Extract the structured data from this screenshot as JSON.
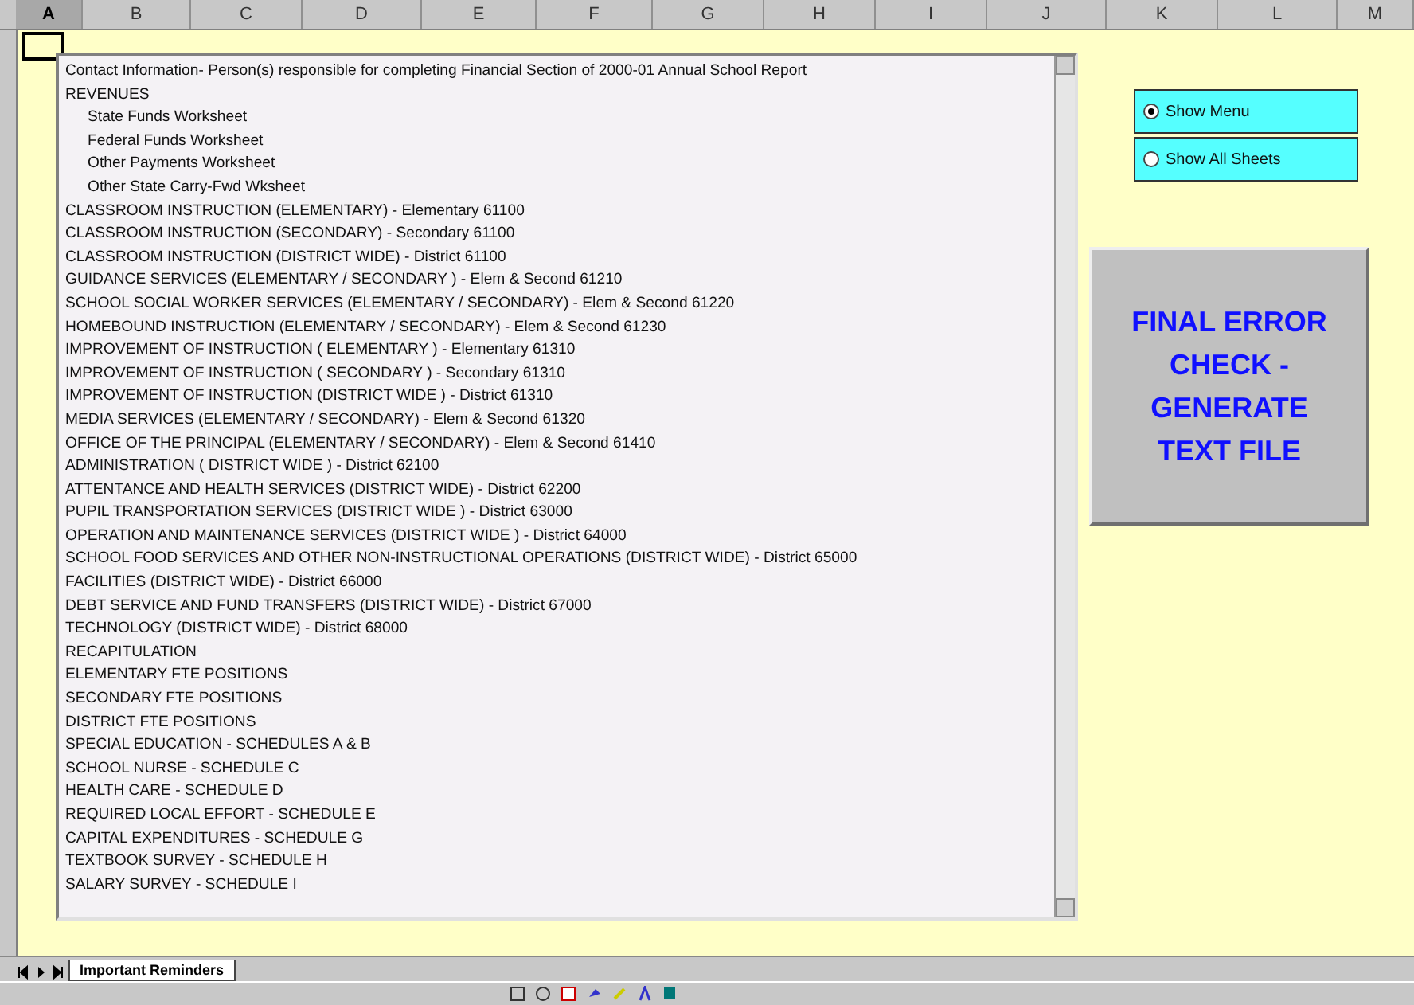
{
  "columns": [
    {
      "label": "A",
      "selected": true
    },
    {
      "label": "B",
      "selected": false
    },
    {
      "label": "C",
      "selected": false
    },
    {
      "label": "D",
      "selected": false
    },
    {
      "label": "E",
      "selected": false
    },
    {
      "label": "F",
      "selected": false
    },
    {
      "label": "G",
      "selected": false
    },
    {
      "label": "H",
      "selected": false
    },
    {
      "label": "I",
      "selected": false
    },
    {
      "label": "J",
      "selected": false
    },
    {
      "label": "K",
      "selected": false
    },
    {
      "label": "L",
      "selected": false
    },
    {
      "label": "M",
      "selected": false
    }
  ],
  "list_items": [
    {
      "text": "Contact Information- Person(s) responsible for completing Financial Section of 2000-01 Annual School Report",
      "indented": false
    },
    {
      "text": "REVENUES",
      "indented": false
    },
    {
      "text": "State Funds Worksheet",
      "indented": true
    },
    {
      "text": "Federal Funds Worksheet",
      "indented": true
    },
    {
      "text": "Other Payments Worksheet",
      "indented": true
    },
    {
      "text": "Other State Carry-Fwd Wksheet",
      "indented": true
    },
    {
      "text": "CLASSROOM INSTRUCTION (ELEMENTARY) - Elementary 61100",
      "indented": false
    },
    {
      "text": "CLASSROOM INSTRUCTION (SECONDARY) - Secondary 61100",
      "indented": false
    },
    {
      "text": "CLASSROOM INSTRUCTION (DISTRICT WIDE) - District 61100",
      "indented": false
    },
    {
      "text": "GUIDANCE SERVICES (ELEMENTARY / SECONDARY ) - Elem & Second 61210",
      "indented": false
    },
    {
      "text": "SCHOOL SOCIAL WORKER SERVICES (ELEMENTARY / SECONDARY) - Elem & Second 61220",
      "indented": false
    },
    {
      "text": "HOMEBOUND INSTRUCTION (ELEMENTARY / SECONDARY) - Elem & Second 61230",
      "indented": false
    },
    {
      "text": "IMPROVEMENT OF INSTRUCTION ( ELEMENTARY ) - Elementary 61310",
      "indented": false
    },
    {
      "text": "IMPROVEMENT OF INSTRUCTION ( SECONDARY ) - Secondary 61310",
      "indented": false
    },
    {
      "text": "IMPROVEMENT OF INSTRUCTION (DISTRICT WIDE ) - District 61310",
      "indented": false
    },
    {
      "text": "MEDIA SERVICES (ELEMENTARY / SECONDARY) - Elem & Second 61320",
      "indented": false
    },
    {
      "text": "OFFICE OF THE PRINCIPAL (ELEMENTARY / SECONDARY) - Elem & Second 61410",
      "indented": false
    },
    {
      "text": "ADMINISTRATION ( DISTRICT WIDE ) - District 62100",
      "indented": false
    },
    {
      "text": "ATTENTANCE AND HEALTH SERVICES (DISTRICT WIDE) - District 62200",
      "indented": false
    },
    {
      "text": "PUPIL TRANSPORTATION SERVICES (DISTRICT WIDE ) - District 63000",
      "indented": false
    },
    {
      "text": "OPERATION AND MAINTENANCE SERVICES (DISTRICT WIDE ) - District 64000",
      "indented": false
    },
    {
      "text": "SCHOOL FOOD SERVICES AND OTHER NON-INSTRUCTIONAL OPERATIONS (DISTRICT WIDE) - District 65000",
      "indented": false
    },
    {
      "text": "FACILITIES (DISTRICT WIDE) - District 66000",
      "indented": false
    },
    {
      "text": "DEBT SERVICE AND FUND TRANSFERS (DISTRICT WIDE) - District 67000",
      "indented": false
    },
    {
      "text": "TECHNOLOGY (DISTRICT WIDE) - District 68000",
      "indented": false
    },
    {
      "text": "RECAPITULATION",
      "indented": false
    },
    {
      "text": "ELEMENTARY FTE POSITIONS",
      "indented": false
    },
    {
      "text": "SECONDARY FTE POSITIONS",
      "indented": false
    },
    {
      "text": "DISTRICT FTE POSITIONS",
      "indented": false
    },
    {
      "text": "SPECIAL EDUCATION - SCHEDULES A & B",
      "indented": false
    },
    {
      "text": "SCHOOL NURSE - SCHEDULE C",
      "indented": false
    },
    {
      "text": "HEALTH CARE - SCHEDULE D",
      "indented": false
    },
    {
      "text": "REQUIRED LOCAL EFFORT - SCHEDULE E",
      "indented": false
    },
    {
      "text": "CAPITAL EXPENDITURES - SCHEDULE G",
      "indented": false
    },
    {
      "text": "TEXTBOOK SURVEY - SCHEDULE H",
      "indented": false
    },
    {
      "text": "SALARY SURVEY - SCHEDULE I",
      "indented": false
    }
  ],
  "view_options": [
    {
      "label": "Show Menu",
      "selected": true
    },
    {
      "label": "Show All Sheets",
      "selected": false
    }
  ],
  "action_button": {
    "label": "FINAL ERROR CHECK - GENERATE TEXT FILE"
  },
  "sheet_tabs": [
    {
      "label": "Important Reminders",
      "selected": true
    }
  ]
}
